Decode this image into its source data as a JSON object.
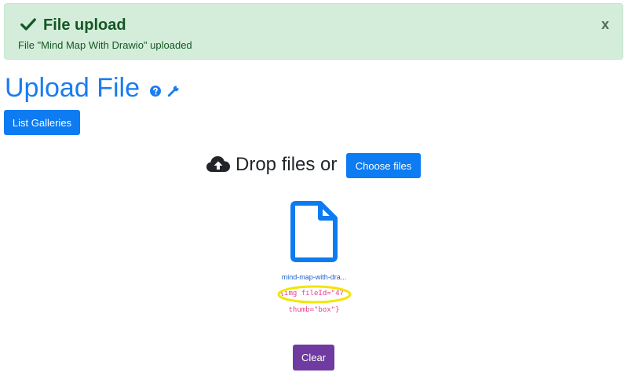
{
  "alert": {
    "title": "File upload",
    "close_label": "x",
    "message": "File \"Mind Map With Drawio\" uploaded",
    "icon": "check-icon"
  },
  "page": {
    "title": "Upload File",
    "icons": [
      "help-icon",
      "wrench-icon"
    ]
  },
  "toolbar": {
    "list_galleries_label": "List Galleries"
  },
  "dropzone": {
    "icon": "cloud-upload-icon",
    "text": "Drop files or",
    "choose_label": "Choose files"
  },
  "uploaded_file": {
    "icon": "file-icon",
    "name": "mind-map-with-dra...",
    "code_line1": "{img fileId=\"47\"",
    "code_line2": "thumb=\"box\"}"
  },
  "actions": {
    "clear_label": "Clear"
  },
  "colors": {
    "alert_bg": "#d4edda",
    "alert_text": "#155724",
    "primary": "#0d7bf2",
    "title": "#1a7cf0",
    "clear_button": "#6f3ba1",
    "code": "#e83e8c",
    "highlight": "#f2e600"
  }
}
